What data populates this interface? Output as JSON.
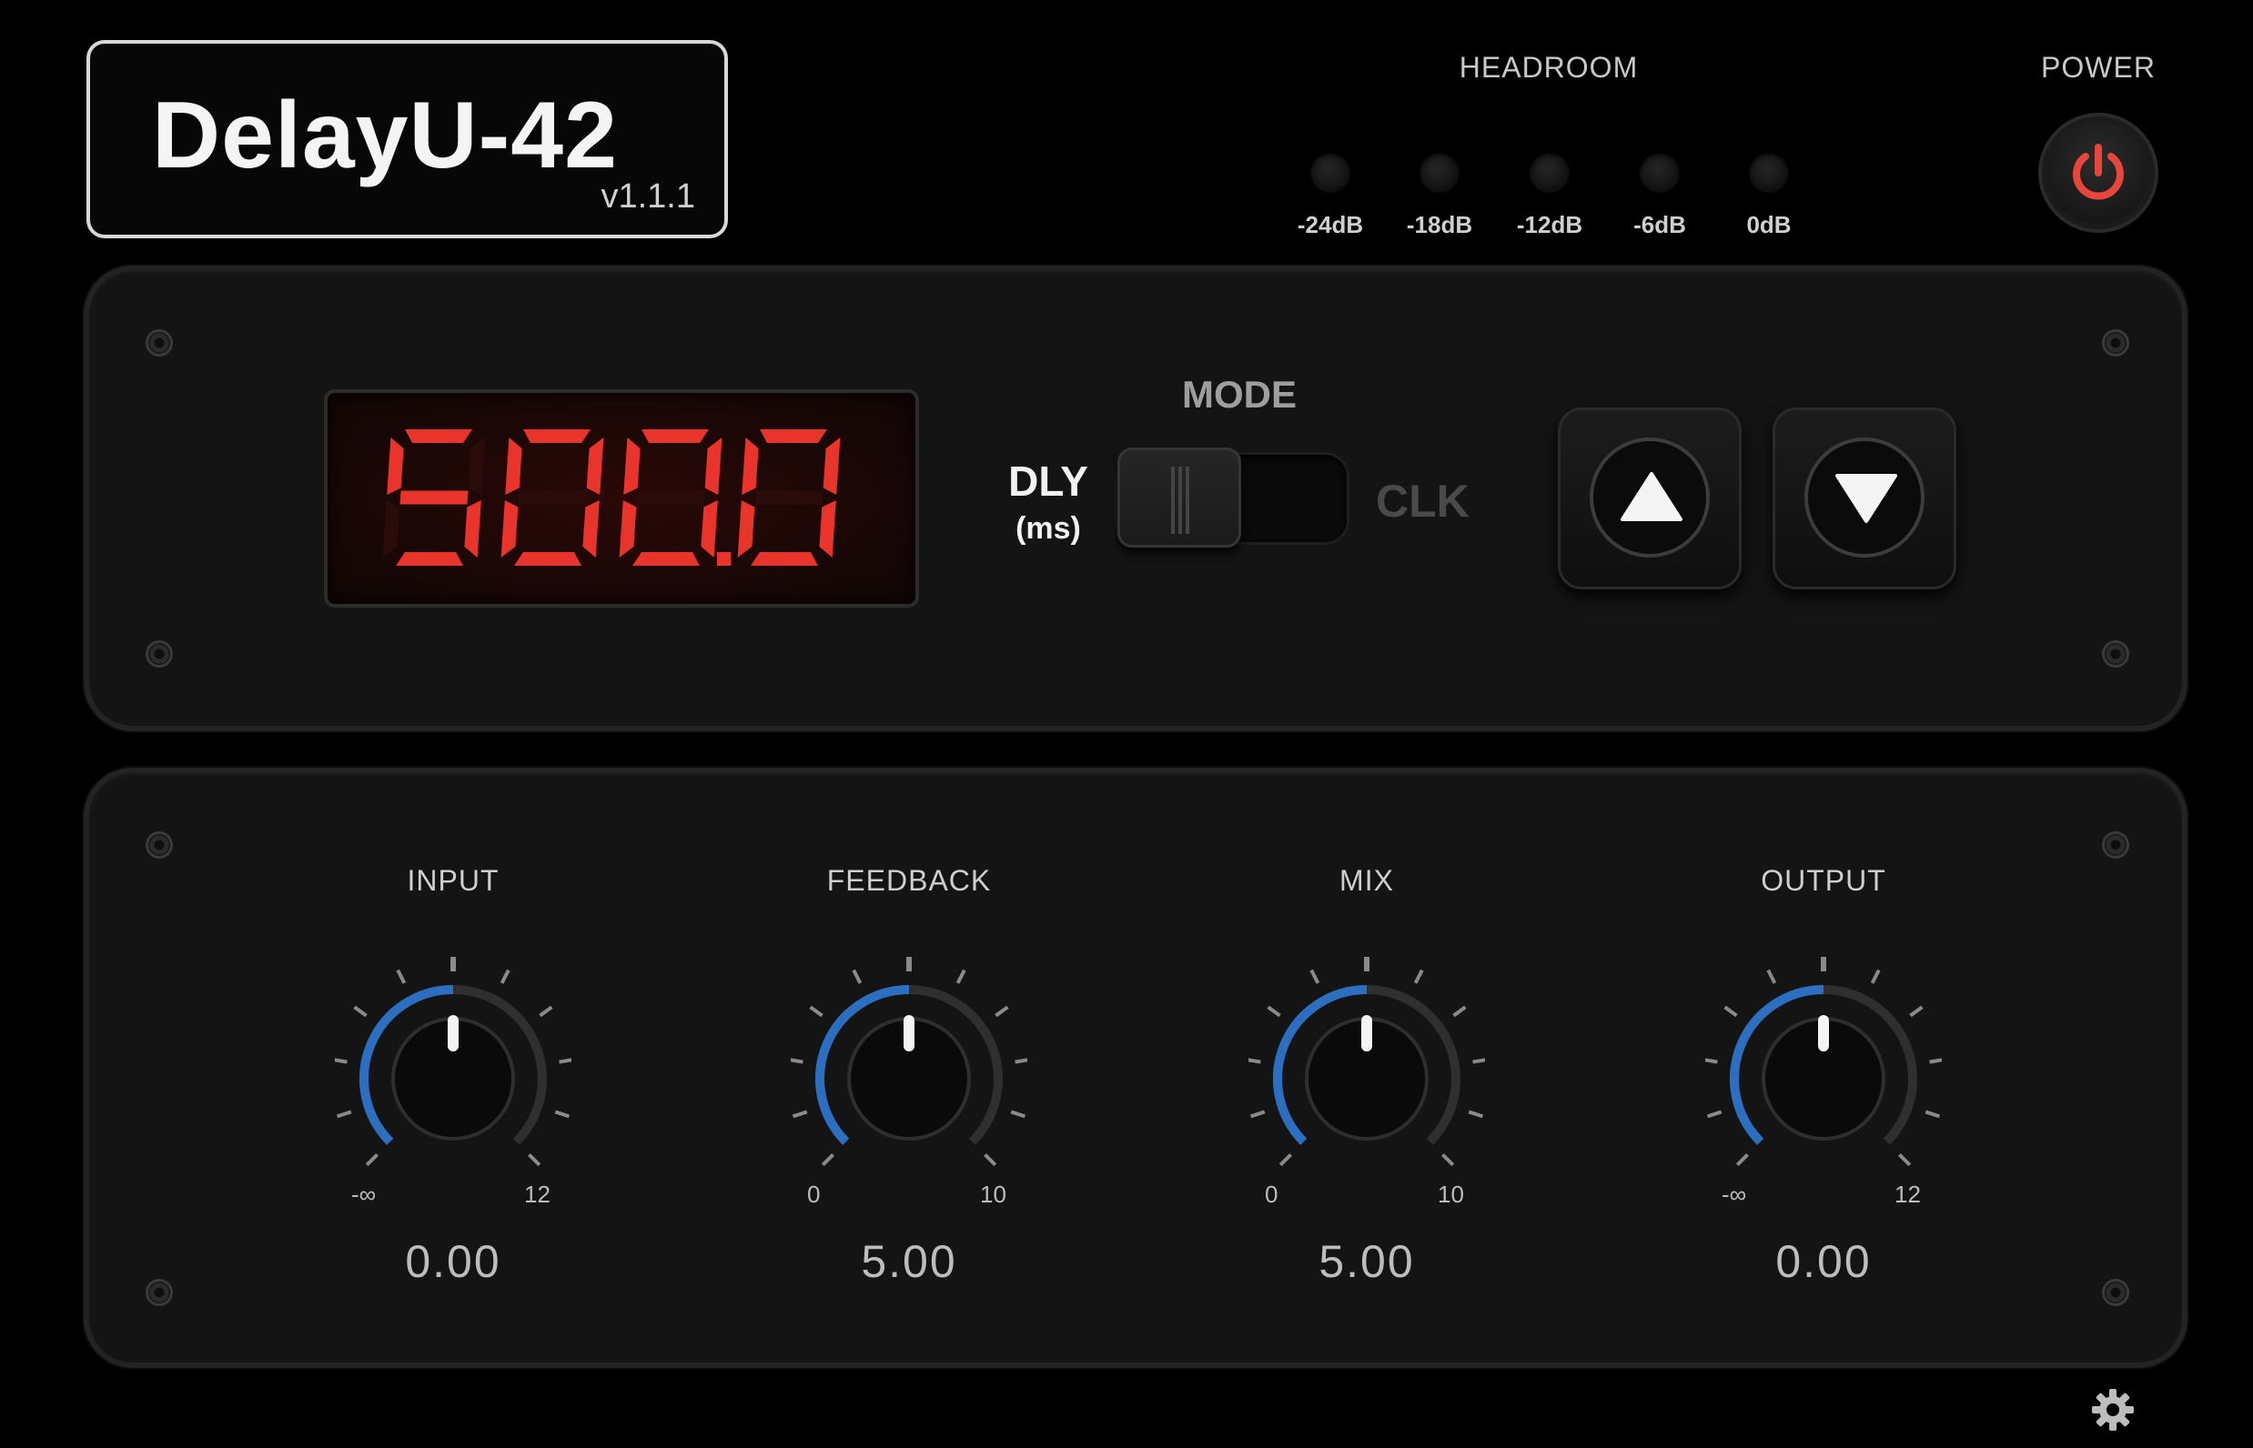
{
  "header": {
    "title": "DelayU-42",
    "version": "v1.1.1"
  },
  "headroom": {
    "title": "HEADROOM",
    "leds": [
      "-24dB",
      "-18dB",
      "-12dB",
      "-6dB",
      "0dB"
    ]
  },
  "power": {
    "title": "POWER",
    "accent": "#e8463c"
  },
  "display": {
    "value": "500.0",
    "color": "#e8342a"
  },
  "mode": {
    "title": "MODE",
    "left_label": "DLY",
    "left_sublabel": "(ms)",
    "right_label": "CLK",
    "selected": "DLY"
  },
  "nudge": {
    "up_icon": "triangle-up-icon",
    "down_icon": "triangle-down-icon"
  },
  "knobs": [
    {
      "id": "input",
      "label": "INPUT",
      "min_label": "-∞",
      "max_label": "12",
      "value_text": "0.00",
      "position": 0.5
    },
    {
      "id": "feedback",
      "label": "FEEDBACK",
      "min_label": "0",
      "max_label": "10",
      "value_text": "5.00",
      "position": 0.5
    },
    {
      "id": "mix",
      "label": "MIX",
      "min_label": "0",
      "max_label": "10",
      "value_text": "5.00",
      "position": 0.5
    },
    {
      "id": "output",
      "label": "OUTPUT",
      "min_label": "-∞",
      "max_label": "12",
      "value_text": "0.00",
      "position": 0.5
    }
  ],
  "colors": {
    "knob_arc": "#2c6fc0",
    "knob_track": "#2f2f2f"
  },
  "footer": {
    "settings_icon": "gear-icon"
  }
}
